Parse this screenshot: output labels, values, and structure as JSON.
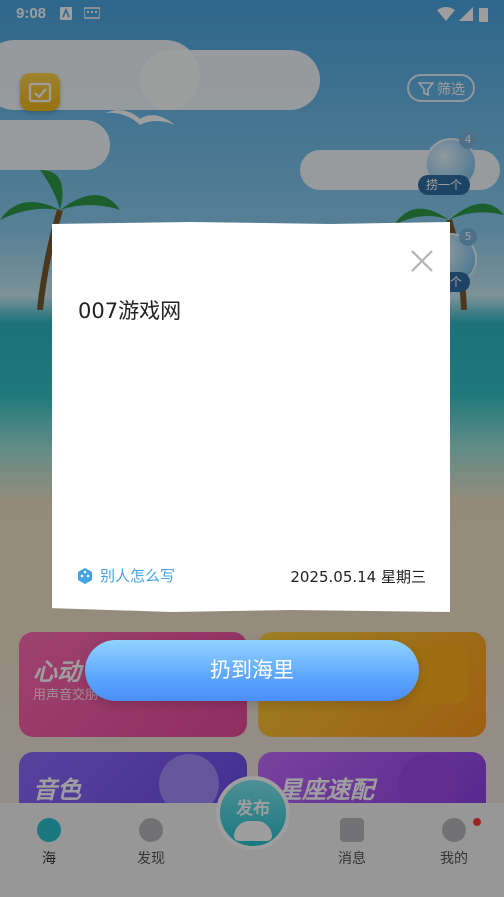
{
  "status_bar": {
    "time": "9:08"
  },
  "header": {
    "filter_label": "筛选"
  },
  "bottles": [
    {
      "label": "捞一个",
      "badge": "4"
    },
    {
      "label": "捞一个",
      "badge": "5"
    }
  ],
  "feature_cards": [
    {
      "title": "心动",
      "subtitle": "用声音交朋"
    },
    {
      "title": "音色",
      "subtitle": ""
    },
    {
      "title": "星座速配",
      "subtitle": ""
    }
  ],
  "tabs": [
    {
      "label": "海"
    },
    {
      "label": "发现"
    },
    {
      "label": "消息"
    },
    {
      "label": "我的"
    }
  ],
  "publish_label": "发布",
  "modal": {
    "message": "007游戏网",
    "others_link": "别人怎么写",
    "date": "2025.05.14 星期三",
    "throw_button": "扔到海里"
  },
  "colors": {
    "accent_blue": "#4b8ef5",
    "link_blue": "#43a4e6",
    "notification_red": "#ff3b3b"
  }
}
